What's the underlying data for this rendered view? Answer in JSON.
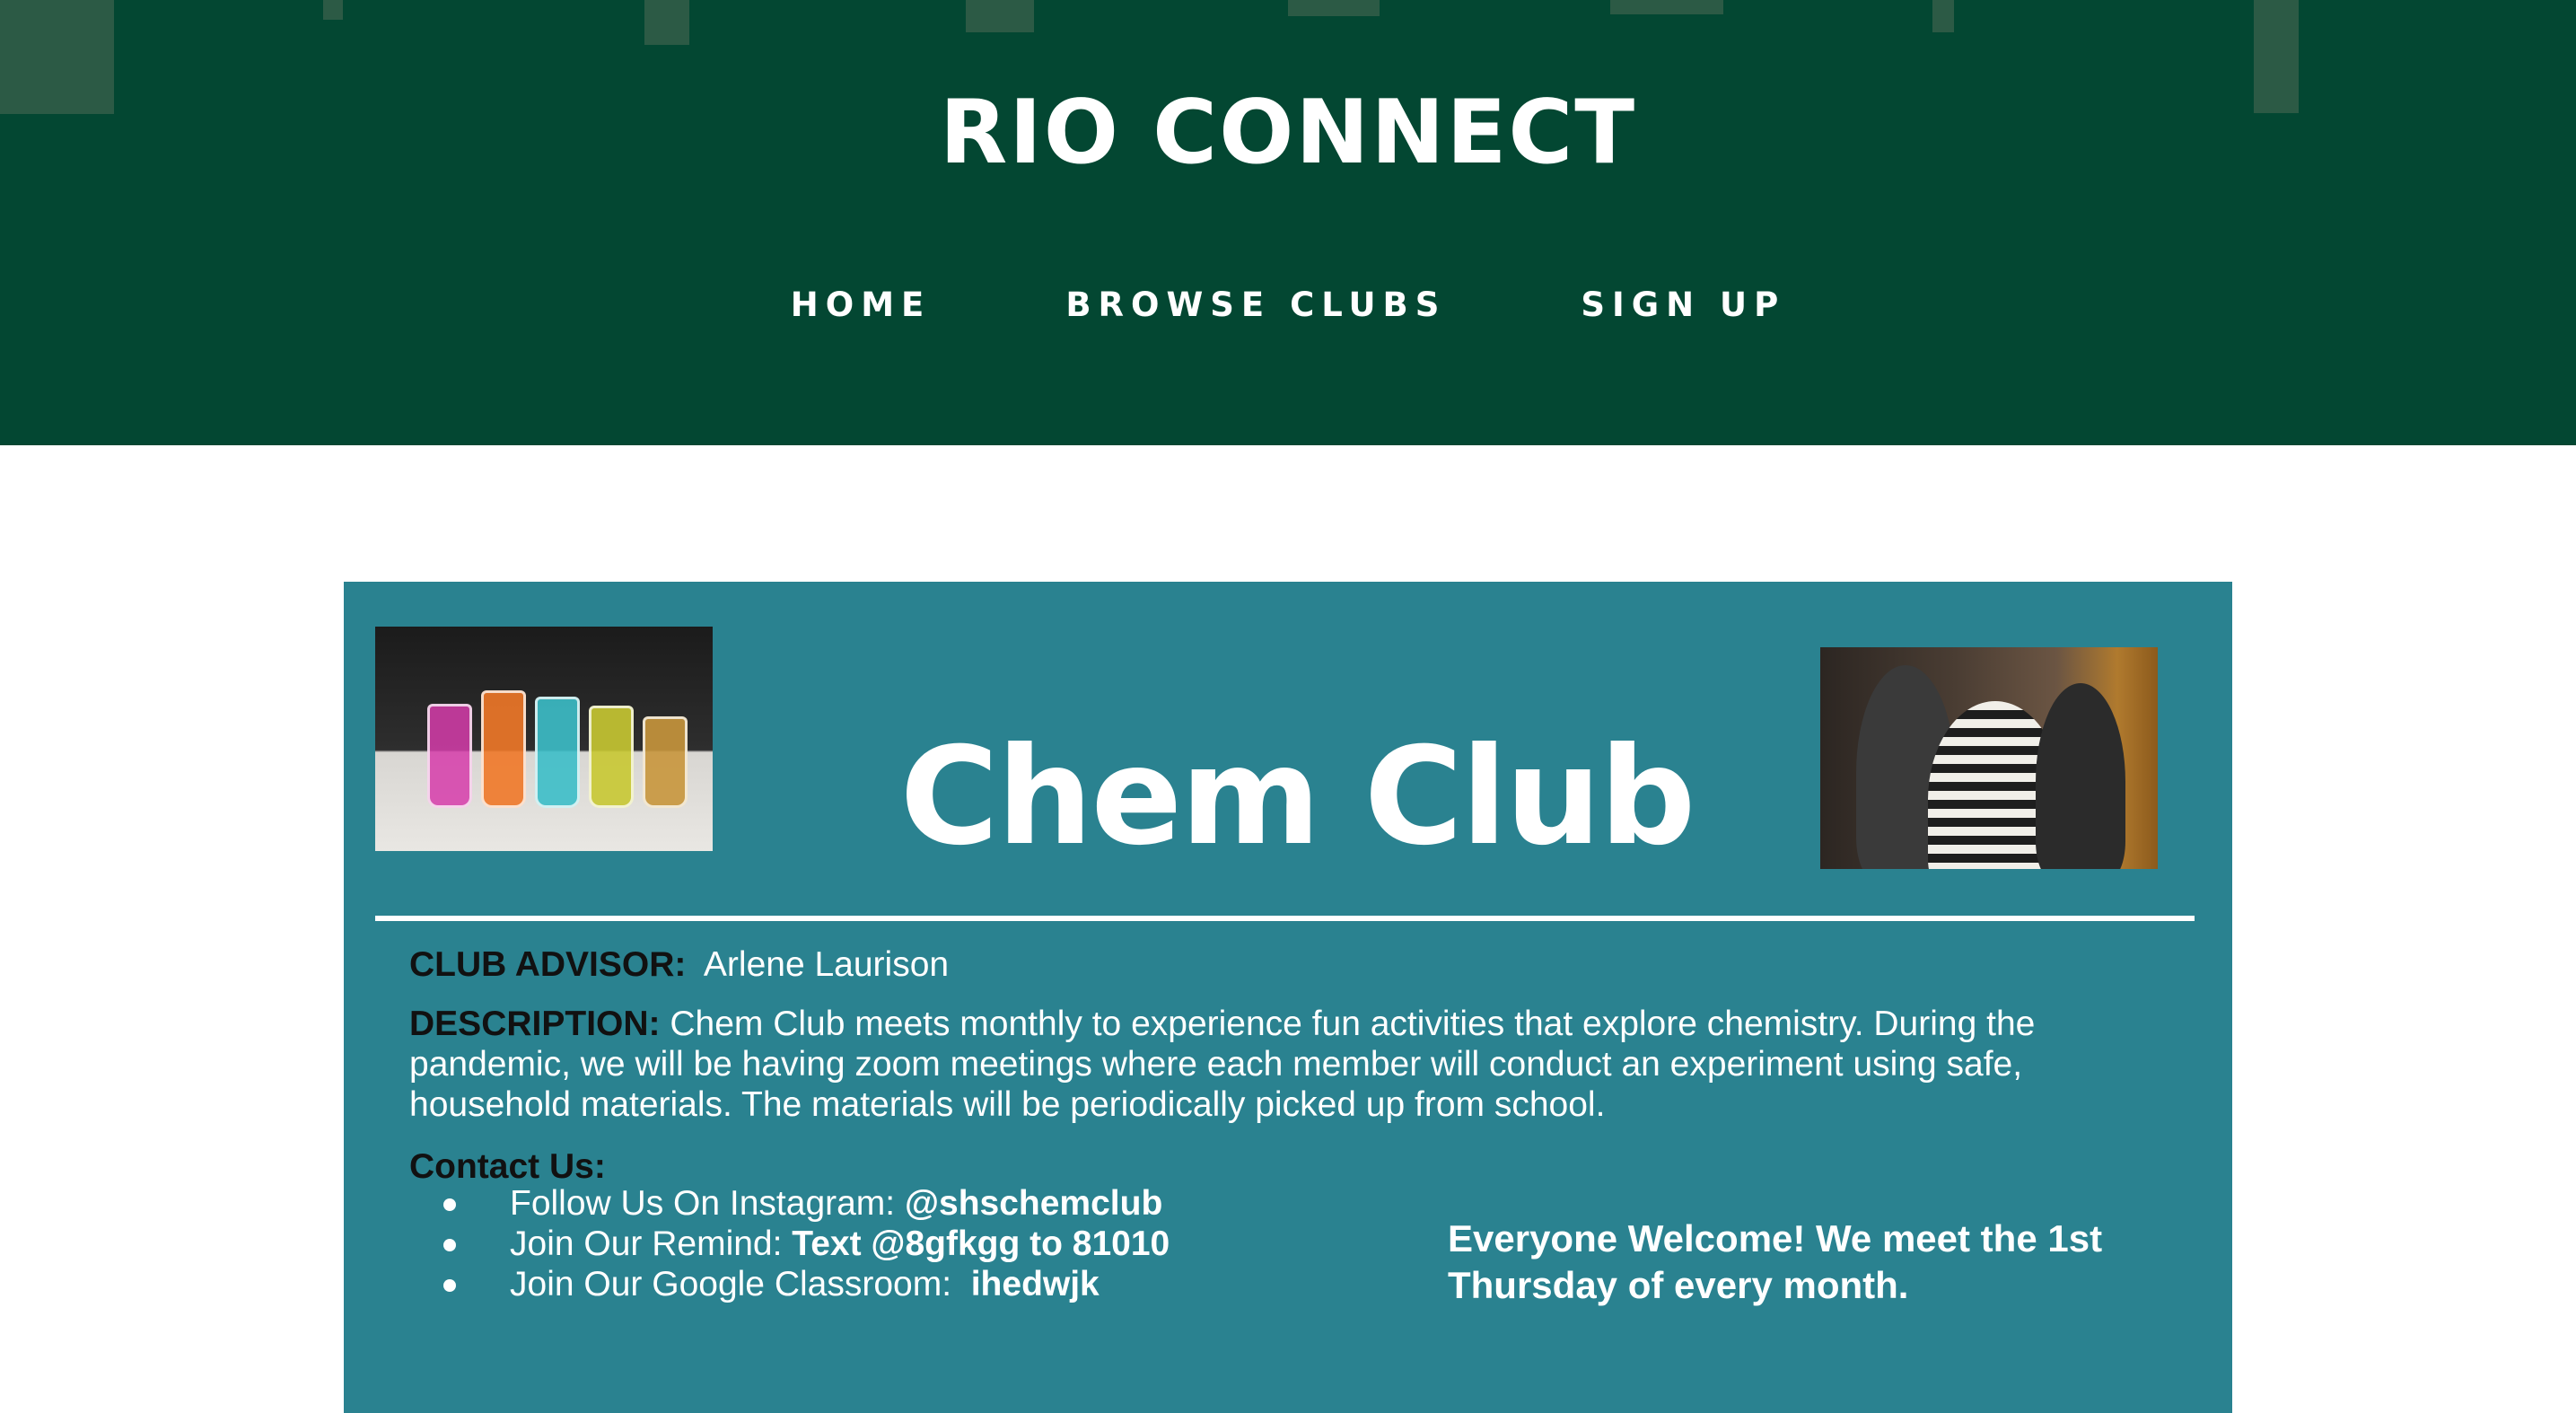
{
  "header": {
    "site_title": "RIO CONNECT",
    "background_color": "#034732",
    "nav": [
      {
        "label": "HOME"
      },
      {
        "label": "BROWSE CLUBS"
      },
      {
        "label": "SIGN UP"
      }
    ]
  },
  "flyer": {
    "background_color": "#2a8290",
    "title": "Chem Club",
    "left_image": "colorful-flasks-photo",
    "right_image": "students-doing-experiment-photo",
    "advisor": {
      "label": "CLUB ADVISOR:",
      "name": "Arlene Laurison"
    },
    "description": {
      "label": "DESCRIPTION:",
      "text": "Chem Club meets monthly to experience fun activities that explore chemistry. During the pandemic, we will be having zoom meetings where each member will conduct an experiment using safe, household materials. The materials will be periodically picked up from school."
    },
    "contact": {
      "heading": "Contact Us:",
      "items": [
        {
          "prefix": "Follow Us On Instagram:",
          "value": "@shschemclub"
        },
        {
          "prefix": "Join Our Remind:",
          "value": "Text @8gfkgg to 81010"
        },
        {
          "prefix": "Join Our Google Classroom:",
          "value": "ihedwjk"
        }
      ]
    },
    "welcome": "Everyone Welcome! We meet the 1st Thursday of every month."
  }
}
